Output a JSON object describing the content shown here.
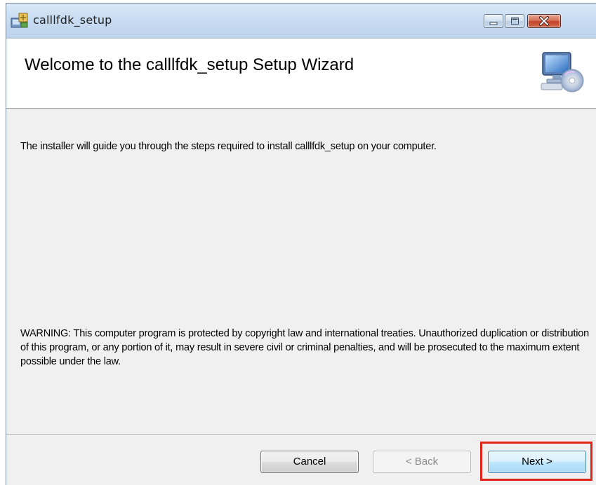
{
  "window": {
    "title": "calllfdk_setup",
    "app_icon": "installer-icon",
    "caption_buttons": [
      "minimize-icon",
      "maximize-icon",
      "close-icon"
    ]
  },
  "header": {
    "title": "Welcome to the calllfdk_setup Setup Wizard",
    "icon": "computer-cd-icon"
  },
  "body": {
    "intro": "The installer will guide you through the steps required to install calllfdk_setup on your computer.",
    "warning": "WARNING: This computer program is protected by copyright law and international treaties. Unauthorized duplication or distribution of this program, or any portion of it, may result in severe civil or criminal penalties, and will be prosecuted to the maximum extent possible under the law."
  },
  "buttons": {
    "cancel": "Cancel",
    "back": "< Back",
    "next": "Next >",
    "back_enabled": false
  },
  "colors": {
    "highlight": "#e2231a",
    "dialog_bg": "#f0f0f0",
    "header_bg": "#ffffff"
  }
}
